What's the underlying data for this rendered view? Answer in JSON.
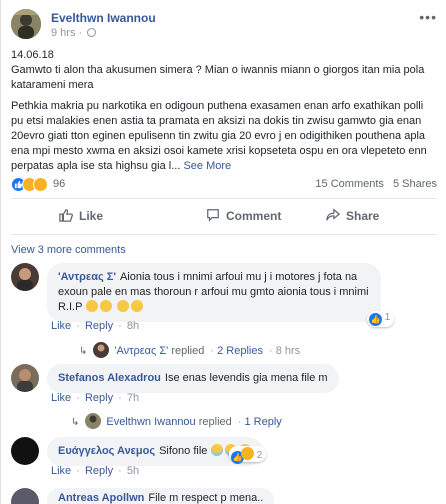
{
  "post": {
    "author": "Evelthwn Iwannou",
    "time": "9 hrs",
    "more": "•••",
    "date_line": "14.06.18",
    "para1": "Gamwto ti alon tha akusumen simera ? Mian o iwannis miann o giorgos itan mia pola katarameni mera",
    "para2": "Pethkia makria pu narkotika en odigoun puthena exasamen enan arfo exathikan polli pu etsi malakies enen astia ta pramata en aksizi na dokis tin zwisu gamwto gia enan 20evro giati tton eginen epulisenn tin zwitu gia 20 evro j en odigithiken pouthena apla ena mpi mesto xwma en aksizi osoi kamete xrisi kopseteta ospu en ora vlepeteto enn perpatas apla ise sta highsu gia l...",
    "see_more": "See More",
    "reaction_count": "96",
    "comments_count": "15 Comments",
    "shares_count": "5 Shares"
  },
  "actions": {
    "like": "Like",
    "comment": "Comment",
    "share": "Share"
  },
  "view_more": "View 3 more comments",
  "comments": [
    {
      "name": "'Αντρεας Σ'",
      "text": "Aionia tous i mnimi arfoui mu j i motores j fota na exoun pale en mas thoroun r arfoui mu gmto aionia tous i mnimi R.I.P",
      "like": "Like",
      "reply": "Reply",
      "time": "8h",
      "reaction_count": "1",
      "replies": {
        "author": "'Αντρεας Σ'",
        "replied": "replied",
        "count": "2 Replies",
        "time": "8 hrs"
      }
    },
    {
      "name": "Stefanos Alexadrou",
      "text": "Ise enas levendis gia mena file m",
      "like": "Like",
      "reply": "Reply",
      "time": "7h",
      "replies": {
        "author": "Evelthwn Iwannou",
        "replied": "replied",
        "count": "1 Reply"
      }
    },
    {
      "name": "Ευάγγελος Ανεμος",
      "text": "Sifono file",
      "like": "Like",
      "reply": "Reply",
      "time": "5h",
      "reaction_count": "2"
    },
    {
      "name": "Antreas Apollwn",
      "text": "File m respect p mena.."
    }
  ],
  "colors": {
    "link": "#385898",
    "name": "#365899",
    "muted": "#90949c",
    "bubble": "#f2f3f5",
    "like_blue": "#1877f2",
    "sad_yellow": "#f7b125"
  }
}
